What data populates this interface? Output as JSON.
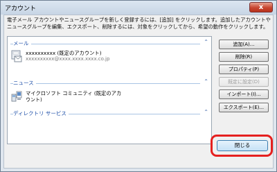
{
  "window": {
    "title": "アカウント",
    "close_glyph": "x"
  },
  "description": "電子メール アカウントやニュースグループを新しく登録するには、[追加] をクリックします。追加したアカウントやニュースグループを編集、エクスポート、削除するには、対象をクリックしてから、希望の動作をクリックします。",
  "groups": {
    "mail": {
      "label": "メール",
      "chevron": "⌃",
      "account": {
        "name": "xxxxxxxxxx (既定のアカウント)",
        "address": "xxxxxxxxxx@xxxx.xxxx.xxxx.co.jp"
      }
    },
    "news": {
      "label": "ニュース",
      "chevron": "⌃",
      "account": {
        "name_line1": "マイクロソフト コミュニティ (既定のアカ",
        "name_line2": "ウント)"
      }
    },
    "directory": {
      "label": "ディレクトリ サービス",
      "chevron": "⌃"
    }
  },
  "buttons": {
    "add": "追加(A)...",
    "remove": "削除(R)",
    "properties": "プロパティ(P)",
    "set_default": "既定に設定(D)",
    "import": "インポート(I)...",
    "export": "エクスポート(E)...",
    "close": "閉じる"
  },
  "colors": {
    "accent": "#1e4fa8",
    "highlight": "#e5201f"
  }
}
